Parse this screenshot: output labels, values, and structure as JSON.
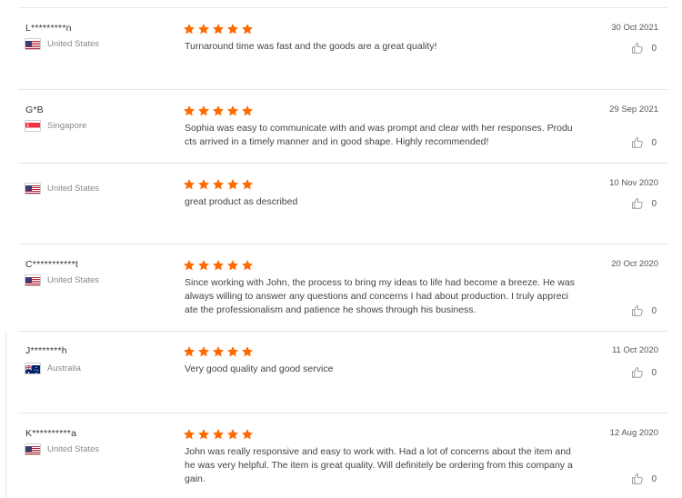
{
  "colors": {
    "star": "#ff6a00",
    "divider": "#e6e6e6",
    "country_text": "#888888"
  },
  "reviews": [
    {
      "reviewer": "L*********n",
      "country": "United States",
      "flag": "us-flag-icon",
      "rating_stars": 5,
      "text": "Turnaround time was fast and the goods are a great quality!",
      "date": "30 Oct 2021",
      "helpful_count": "0"
    },
    {
      "reviewer": "G*B",
      "country": "Singapore",
      "flag": "singapore-flag-icon",
      "rating_stars": 5,
      "text": "Sophia was easy to communicate with and was prompt and clear with her responses. Produ\ncts arrived in a timely manner and in good shape. Highly recommended!",
      "date": "29 Sep 2021",
      "helpful_count": "0"
    },
    {
      "reviewer": "",
      "country": "United States",
      "flag": "us-flag-icon",
      "rating_stars": 5,
      "text": "great product as described",
      "date": "10 Nov 2020",
      "helpful_count": "0"
    },
    {
      "reviewer": "C***********t",
      "country": "United States",
      "flag": "us-flag-icon",
      "rating_stars": 5,
      "text": "Since working with John, the process to bring my ideas to life had become a breeze. He was\nalways willing to answer any questions and concerns I had about production. I truly appreci\nate the professionalism and patience he shows through his business.",
      "date": "20 Oct 2020",
      "helpful_count": "0"
    },
    {
      "reviewer": "J********h",
      "country": "Australia",
      "flag": "australia-flag-icon",
      "rating_stars": 5,
      "text": "Very good quality and good service",
      "date": "11 Oct 2020",
      "helpful_count": "0"
    },
    {
      "reviewer": "K**********a",
      "country": "United States",
      "flag": "us-flag-icon",
      "rating_stars": 5,
      "text": "John was really responsive and easy to work with. Had a lot of concerns about the item and\nhe was very helpful. The item is great quality. Will definitely be ordering from this company a\ngain.",
      "date": "12 Aug 2020",
      "helpful_count": "0"
    }
  ]
}
